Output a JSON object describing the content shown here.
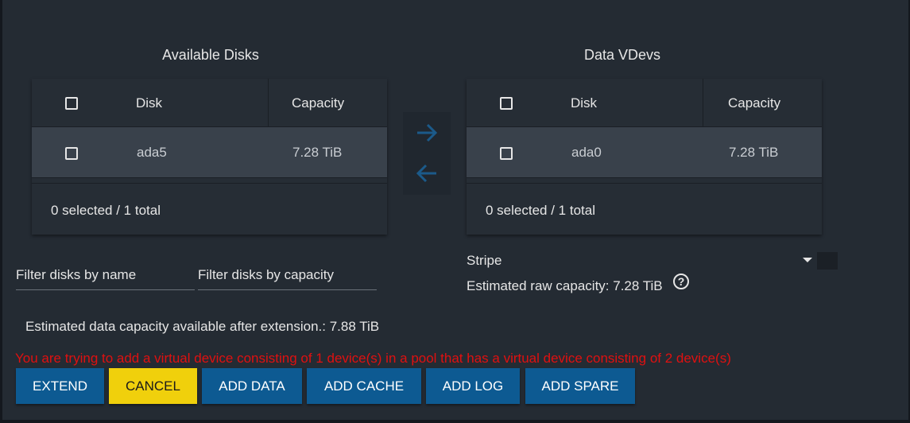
{
  "available": {
    "title": "Available Disks",
    "col_disk": "Disk",
    "col_capacity": "Capacity",
    "rows": [
      {
        "disk": "ada5",
        "capacity": "7.28 TiB"
      }
    ],
    "footer": "0 selected / 1 total"
  },
  "vdevs": {
    "title": "Data VDevs",
    "col_disk": "Disk",
    "col_capacity": "Capacity",
    "rows": [
      {
        "disk": "ada0",
        "capacity": "7.28 TiB"
      }
    ],
    "footer": "0 selected / 1 total"
  },
  "filters": {
    "name_placeholder": "Filter disks by name",
    "capacity_placeholder": "Filter disks by capacity"
  },
  "layout": {
    "type_value": "Stripe",
    "raw_capacity": "Estimated raw capacity: 7.28 TiB"
  },
  "estimate": "Estimated data capacity available after extension.: 7.88 TiB",
  "warning": "You are trying to add a virtual device consisting of 1 device(s) in a pool that has a virtual device consisting of 2 device(s)",
  "buttons": {
    "extend": "EXTEND",
    "cancel": "CANCEL",
    "add_data": "ADD DATA",
    "add_cache": "ADD CACHE",
    "add_log": "ADD LOG",
    "add_spare": "ADD SPARE"
  },
  "colors": {
    "primary": "#0d5a92",
    "cancel": "#f0d00c",
    "warning": "#e01010",
    "arrow": "#1b5a8a"
  },
  "icons": {
    "move_right": "arrow-right-icon",
    "move_left": "arrow-left-icon",
    "help": "help-circle-icon",
    "dropdown": "caret-down-icon"
  }
}
